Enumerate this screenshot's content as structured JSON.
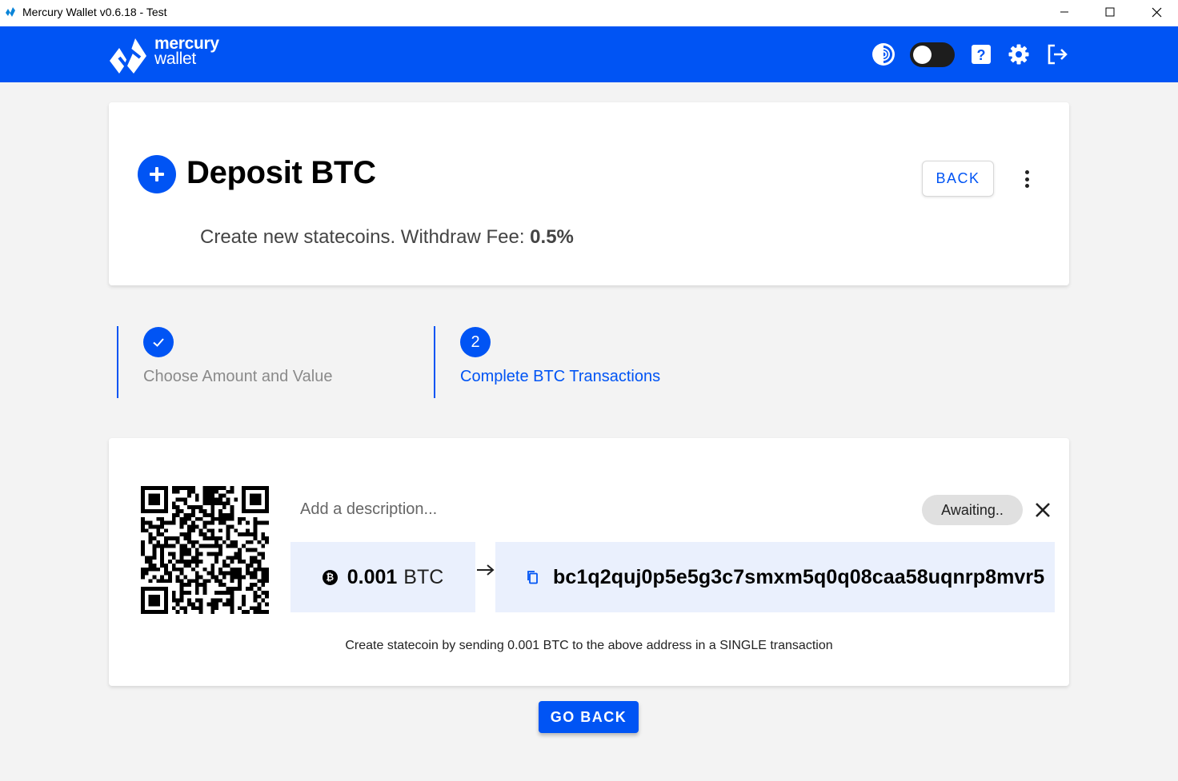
{
  "window": {
    "title": "Mercury Wallet v0.6.18 - Test"
  },
  "header": {
    "logo_line1": "mercury",
    "logo_line2": "wallet",
    "icons": [
      "tor-icon",
      "theme-toggle",
      "help-icon",
      "settings-icon",
      "logout-icon"
    ],
    "help_glyph": "?",
    "brand_color": "#0054f4"
  },
  "page": {
    "title": "Deposit BTC",
    "subtitle_prefix": "Create new statecoins. Withdraw Fee: ",
    "withdraw_fee": "0.5%",
    "back_label": "BACK"
  },
  "stepper": {
    "steps": [
      {
        "marker": "check-icon",
        "label": "Choose Amount and Value"
      },
      {
        "marker": "2",
        "label": "Complete BTC Transactions"
      }
    ]
  },
  "deposit": {
    "description_placeholder": "Add a description...",
    "status": "Awaiting..",
    "amount": "0.001",
    "unit": "BTC",
    "btc_glyph": "₿",
    "address": "bc1q2quj0p5e5g3c7smxm5q0q08caa58uqnrp8mvr5",
    "instruction": "Create statecoin by sending 0.001 BTC to the above address in a SINGLE transaction"
  },
  "footer": {
    "go_back_label": "GO BACK"
  }
}
